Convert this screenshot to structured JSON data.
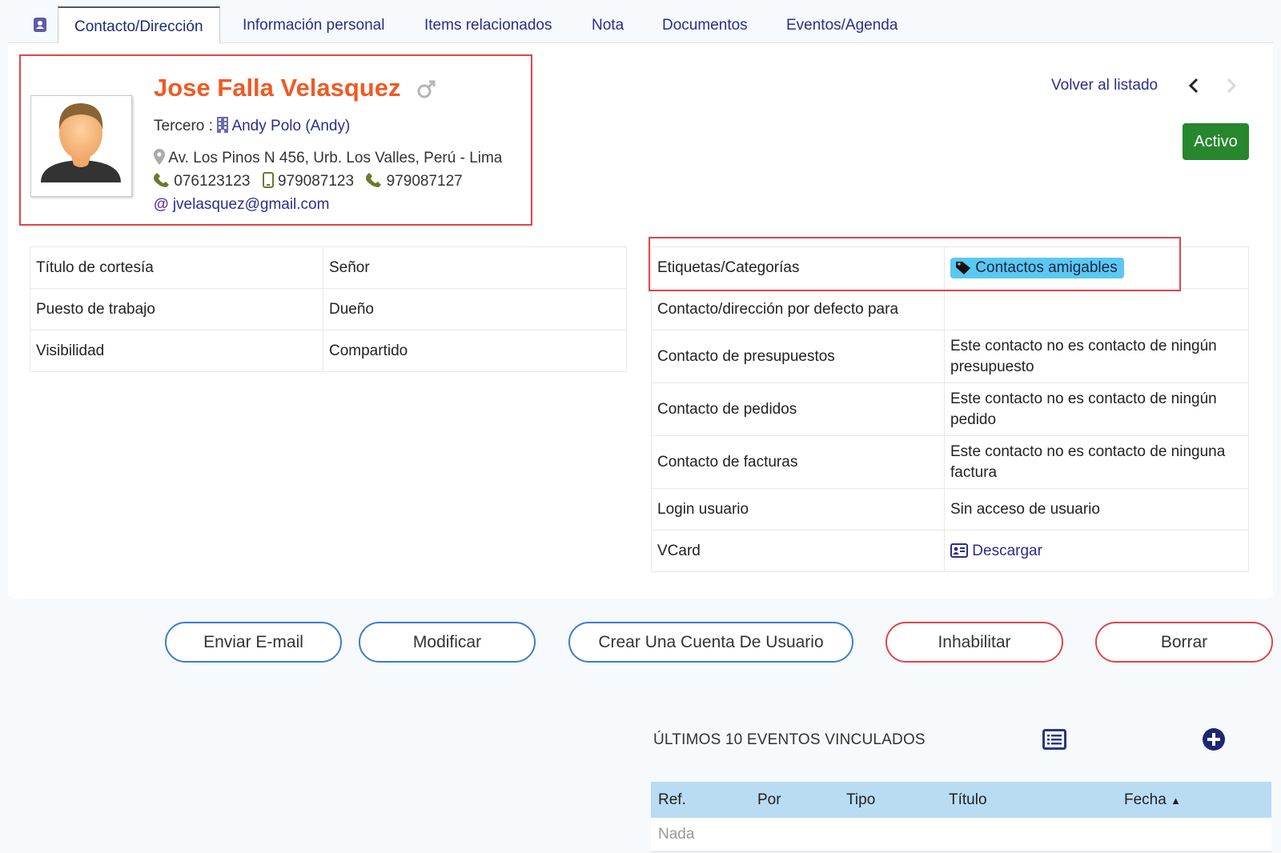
{
  "tabs": [
    {
      "label": "Contacto/Dirección",
      "active": true
    },
    {
      "label": "Información personal"
    },
    {
      "label": "Items relacionados"
    },
    {
      "label": "Nota"
    },
    {
      "label": "Documentos"
    },
    {
      "label": "Eventos/Agenda"
    }
  ],
  "contact": {
    "name": "Jose Falla Velasquez",
    "third_party_label": "Tercero :",
    "third_party_name": "Andy Polo (Andy)",
    "address": "Av. Los Pinos N 456, Urb. Los Valles, Perú - Lima",
    "phone_office": "076123123",
    "phone_mobile": "979087123",
    "phone_home": "979087127",
    "email": "jvelasquez@gmail.com"
  },
  "nav": {
    "back_label": "Volver al listado"
  },
  "status": {
    "label": "Activo",
    "color": "#27872d"
  },
  "left_fields": [
    {
      "label": "Título de cortesía",
      "value": "Señor"
    },
    {
      "label": "Puesto de trabajo",
      "value": "Dueño"
    },
    {
      "label": "Visibilidad",
      "value": "Compartido"
    }
  ],
  "right_fields": {
    "tags_label": "Etiquetas/Categorías",
    "tag_value": "Contactos amigables",
    "default_for_label": "Contacto/dirección por defecto para",
    "default_for_value": "",
    "proposals_label": "Contacto de presupuestos",
    "proposals_value": "Este contacto no es contacto de ningún presupuesto",
    "orders_label": "Contacto de pedidos",
    "orders_value": "Este contacto no es contacto de ningún pedido",
    "invoices_label": "Contacto de facturas",
    "invoices_value": "Este contacto no es contacto de ninguna factura",
    "login_label": "Login usuario",
    "login_value": "Sin acceso de usuario",
    "vcard_label": "VCard",
    "vcard_value": "Descargar"
  },
  "actions": {
    "send_email": "Enviar E-mail",
    "modify": "Modificar",
    "create_user": "Crear Una Cuenta De Usuario",
    "disable": "Inhabilitar",
    "delete": "Borrar"
  },
  "events": {
    "title": "ÚLTIMOS 10 EVENTOS VINCULADOS",
    "columns": [
      "Ref.",
      "Por",
      "Tipo",
      "Título",
      "Fecha"
    ],
    "sort_indicator": "▲",
    "empty_text": "Nada"
  },
  "colors": {
    "name": "#f05a24",
    "link": "#2a2e8a",
    "highlight": "#e0454a",
    "tag_bg": "#5bc8f0",
    "table_header": "#b9dcf3"
  },
  "icons": {
    "tab": "contact-card-icon",
    "gender": "male-icon",
    "third_party": "building-icon",
    "address": "map-marker-icon",
    "phone": "phone-icon",
    "mobile": "mobile-icon",
    "email": "at-icon",
    "tag": "tag-icon",
    "vcard": "id-card-icon",
    "prev": "chevron-left-icon",
    "next": "chevron-right-icon",
    "list": "list-icon",
    "add": "plus-circle-icon"
  }
}
